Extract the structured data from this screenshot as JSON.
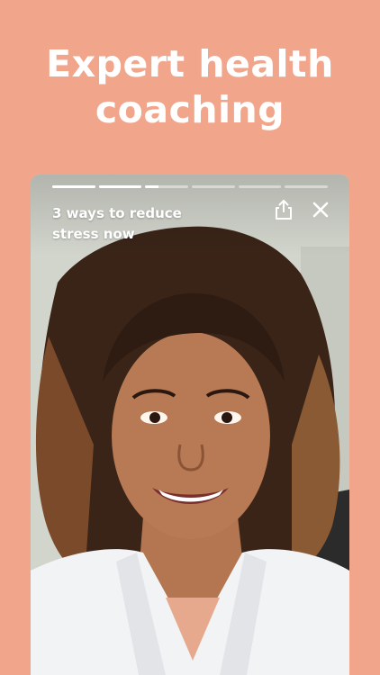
{
  "headline": {
    "line1": "Expert health",
    "line2": "coaching"
  },
  "story": {
    "title": "3 ways to reduce stress now",
    "progress": [
      1.0,
      1.0,
      0.3,
      0,
      0,
      0
    ],
    "share_icon": "share-icon",
    "close_icon": "close-icon"
  },
  "colors": {
    "background": "#F1A68C",
    "text": "#FFFFFF"
  }
}
